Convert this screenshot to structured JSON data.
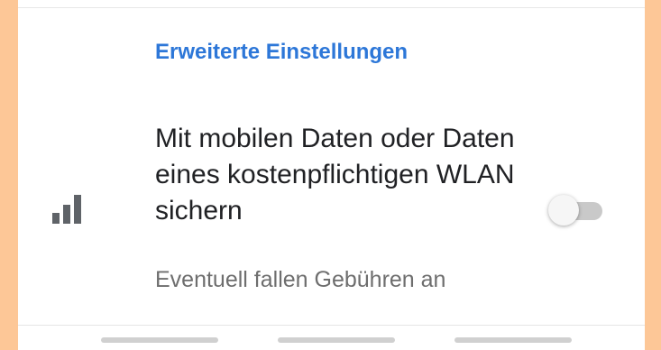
{
  "section": {
    "header": "Erweiterte Einstellungen"
  },
  "setting": {
    "icon": "signal-cellular-icon",
    "title": "Mit mobilen Daten oder Daten eines kostenpflichtigen WLAN sichern",
    "summary": "Eventuell fallen Gebühren an",
    "enabled": false
  },
  "colors": {
    "background": "#fdc797",
    "accent": "#2d77d8",
    "title_text": "#202124",
    "summary_text": "#6e6e6e"
  }
}
